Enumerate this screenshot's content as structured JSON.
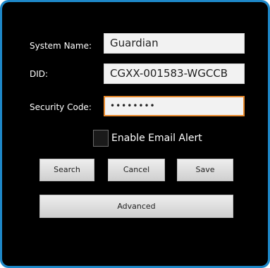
{
  "form": {
    "system_name": {
      "label": "System Name:",
      "value": "Guardian"
    },
    "did": {
      "label": "DID:",
      "value": "CGXX-001583-WGCCB"
    },
    "security_code": {
      "label": "Security Code:",
      "value": "••••••••"
    },
    "email_alert": {
      "label": "Enable Email Alert",
      "checked": false
    }
  },
  "buttons": {
    "search": "Search",
    "cancel": "Cancel",
    "save": "Save",
    "advanced": "Advanced"
  },
  "colors": {
    "frame_border": "#1e88c9",
    "focus_outline": "#e8892c",
    "background": "#000000"
  }
}
